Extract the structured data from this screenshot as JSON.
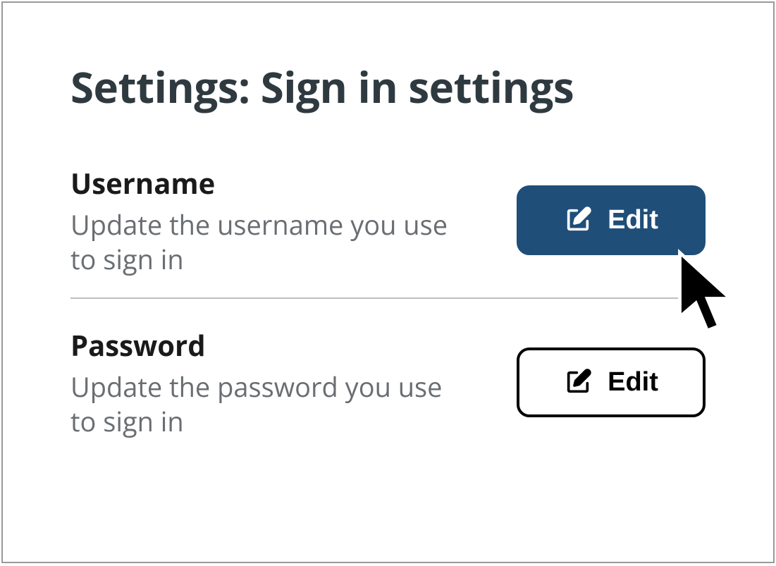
{
  "page": {
    "title": "Settings: Sign in settings"
  },
  "settings": {
    "username": {
      "label": "Username",
      "description": "Update the username you use to sign in",
      "button_label": "Edit"
    },
    "password": {
      "label": "Password",
      "description": "Update the password you use to sign in",
      "button_label": "Edit"
    }
  },
  "colors": {
    "primary": "#1f4e79",
    "heading": "#2f3a40",
    "muted": "#6a6e72"
  }
}
